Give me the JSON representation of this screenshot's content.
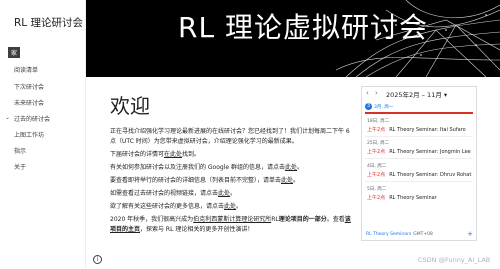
{
  "site": {
    "title": "RL 理论研讨会"
  },
  "nav": {
    "items": [
      {
        "label": "家"
      },
      {
        "label": "阅读清单"
      },
      {
        "label": "下次研讨会"
      },
      {
        "label": "未来研讨会"
      },
      {
        "label": "过去的研讨会"
      },
      {
        "label": "上图工作坊"
      },
      {
        "label": "指示"
      },
      {
        "label": "关于"
      }
    ]
  },
  "banner": {
    "title": "RL 理论虚拟研讨会"
  },
  "main": {
    "heading": "欢迎",
    "p1": "正在寻找介绍强化学习理论最新进展的在线研讨会？您已经找到了！我们计划每周二下午 6 点（UTC 时间）为您带来虚拟研讨会，介绍理论强化学习的最新成果。",
    "p2_pre": "下届研讨会的详情可",
    "p2_link": "在此处",
    "p2_post": "找到。",
    "p3_pre": "有关如何参加研讨会以及注册我们的 Google 群组的信息，请点击",
    "p3_link": "此处",
    "p3_post": "。",
    "p4_pre": "要查看即将举行的研讨会的详细信息（列表目前不完整），请单击",
    "p4_link": "此处",
    "p4_post": "。",
    "p5_pre": "如需查看过去研讨会的视频链接，请点击",
    "p5_link": "此处",
    "p5_post": "。",
    "p6_pre": "欲了解有关这些研讨会的更多信息，请点击",
    "p6_link": "此处",
    "p6_post": "。",
    "p7_a": "2020 年秋季，我们很高兴成为",
    "p7_link1": "伯克利西蒙斯计算理论研究所",
    "p7_b": "RL",
    "p7_bold": "理论项目的一部分",
    "p7_c": "。查看",
    "p7_link2": "该项目的主页",
    "p7_d": "，探索与 RL 理论相关的更多开创性演讲！"
  },
  "calendar": {
    "prev": "‹",
    "next": "›",
    "range": "2025年2月 – 11月",
    "dropdown": "▾",
    "today_num": "3",
    "today_label": "3月, 周一",
    "events": [
      {
        "date": "18日, 周二",
        "time": "上午2点",
        "title": "RL Theory Seminar: Itai Sufaro"
      },
      {
        "date": "25日, 周二",
        "time": "上午2点",
        "title": "RL Theory Seminar: Jongmin Lee"
      },
      {
        "date": "4日, 周二",
        "time": "上午2点",
        "title": "RL Theory Seminar: Dhruv Rohat"
      },
      {
        "date": "5日, 周二",
        "time": "上午2点",
        "title": "RL Theory Seminar"
      }
    ],
    "footer": "RL Theory Seminars",
    "timezone": "GMT+08",
    "plus": "+"
  },
  "watermark": "CSDN @Funny_AI_LAB"
}
